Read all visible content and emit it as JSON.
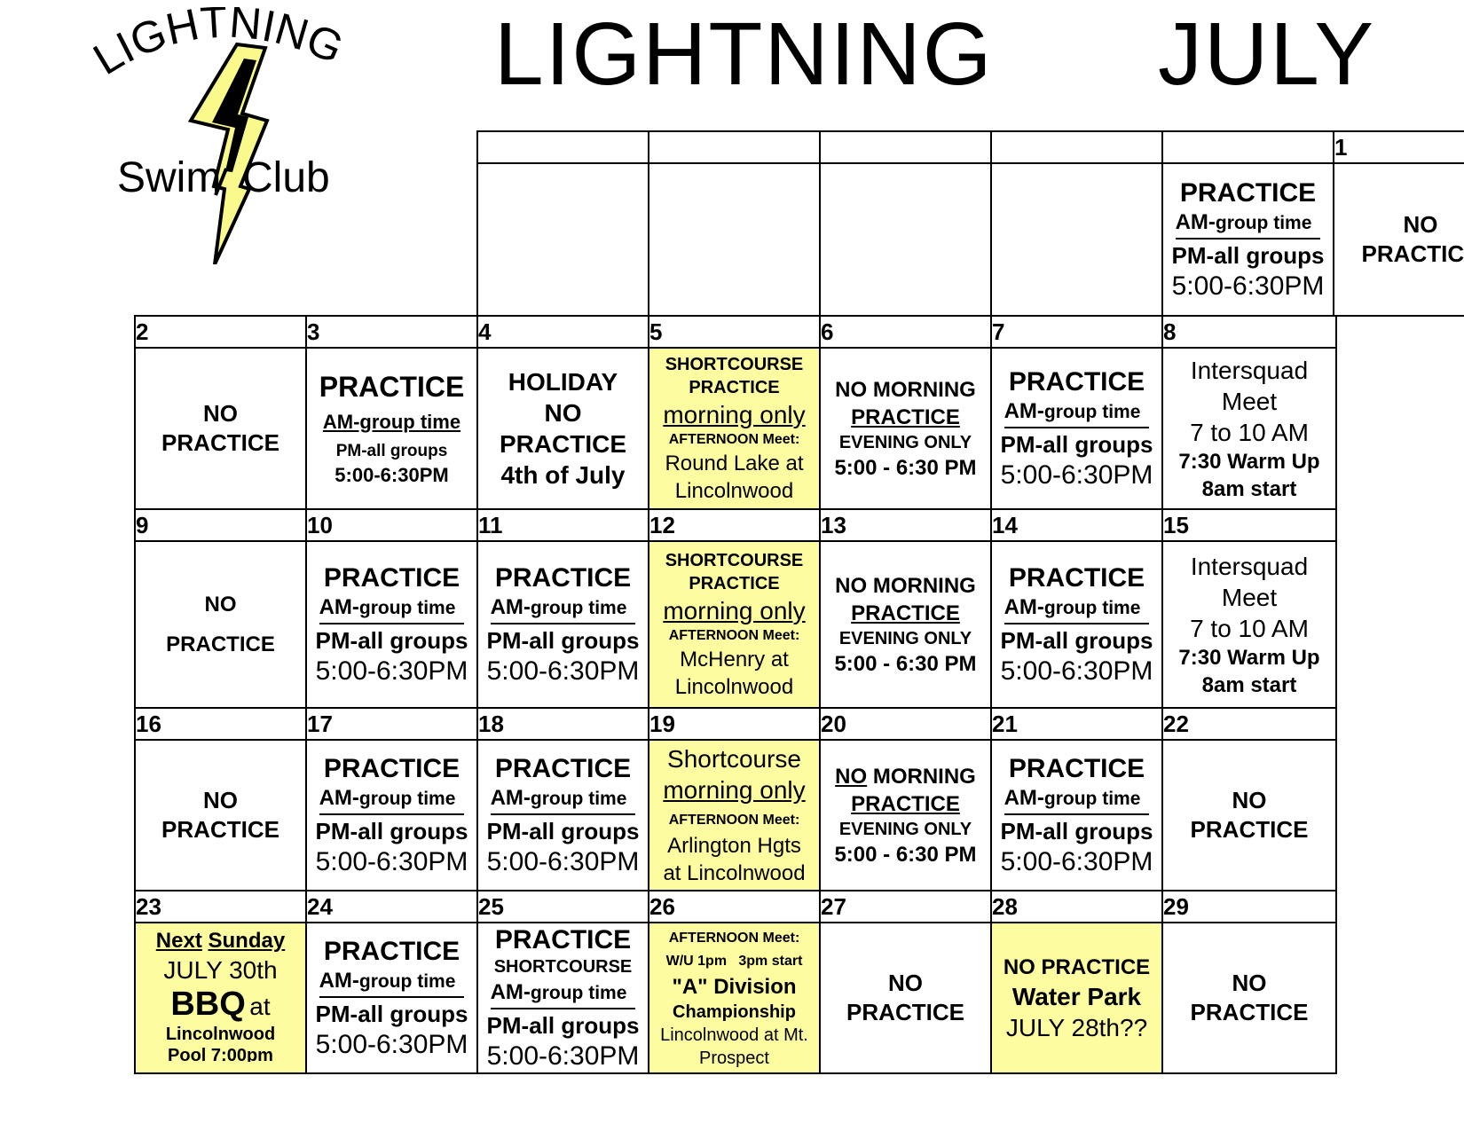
{
  "logo": {
    "top_text": "LIGHTNING",
    "left_text": "Swim",
    "right_text": "Club"
  },
  "title": {
    "left": "LIGHTNING",
    "right": "JULY"
  },
  "week1": {
    "day_numbers": [
      "",
      "",
      "",
      "",
      "",
      "1"
    ],
    "sat30": {
      "l1": "PRACTICE",
      "l2a": "AM-",
      "l2b": "group time",
      "l3": "PM-all groups",
      "l4": "5:00-6:30PM"
    },
    "sun1": {
      "l1": "NO",
      "l2": "PRACTICE"
    }
  },
  "weeks": [
    {
      "days": [
        "2",
        "3",
        "4",
        "5",
        "6",
        "7",
        "8"
      ],
      "mon": {
        "l1": "NO",
        "l2": "PRACTICE"
      },
      "tue": {
        "l1": "PRACTICE",
        "l2": "AM-group time",
        "l3": "PM-all groups",
        "l4": "5:00-6:30PM"
      },
      "wed": {
        "l1": "HOLIDAY",
        "l2": "NO",
        "l3": "PRACTICE",
        "l4": "4th of July"
      },
      "thu": {
        "l1": "SHORTCOURSE",
        "l2": "PRACTICE",
        "l3": "morning only",
        "l4": "AFTERNOON Meet:",
        "l5": "Round Lake at",
        "l6": "Lincolnwood"
      },
      "fri": {
        "l1": "NO MORNING",
        "l2": "PRACTICE",
        "l3": "EVENING ONLY",
        "l4": "5:00 - 6:30 PM"
      },
      "sat": {
        "l1": "PRACTICE",
        "l2a": "AM-",
        "l2b": "group time",
        "l3": "PM-all groups",
        "l4": "5:00-6:30PM"
      },
      "sun": {
        "l1": "Intersquad",
        "l2": "Meet",
        "l3": "7 to 10 AM",
        "l4": "7:30 Warm Up",
        "l5": "8am start"
      }
    },
    {
      "days": [
        "9",
        "10",
        "11",
        "12",
        "13",
        "14",
        "15"
      ],
      "mon": {
        "l1": "NO",
        "l2": "PRACTICE"
      },
      "tue": {
        "l1": "PRACTICE",
        "l2a": "AM-",
        "l2b": "group time",
        "l3": "PM-all groups",
        "l4": "5:00-6:30PM"
      },
      "wed": {
        "l1": "PRACTICE",
        "l2a": "AM-",
        "l2b": "group time",
        "l3": "PM-all groups",
        "l4": "5:00-6:30PM"
      },
      "thu": {
        "l1": "SHORTCOURSE",
        "l2": "PRACTICE",
        "l3": "morning only",
        "l4": "AFTERNOON Meet:",
        "l5": "McHenry at",
        "l6": "Lincolnwood"
      },
      "fri": {
        "l1": "NO MORNING",
        "l2": "PRACTICE",
        "l3": "EVENING ONLY",
        "l4": "5:00 - 6:30 PM"
      },
      "sat": {
        "l1": "PRACTICE",
        "l2a": "AM-",
        "l2b": "group time",
        "l3": "PM-all groups",
        "l4": "5:00-6:30PM"
      },
      "sun": {
        "l1": "Intersquad",
        "l2": "Meet",
        "l3": "7 to 10 AM",
        "l4": "7:30 Warm Up",
        "l5": "8am start"
      }
    },
    {
      "days": [
        "16",
        "17",
        "18",
        "19",
        "20",
        "21",
        "22"
      ],
      "mon": {
        "l1": "NO",
        "l2": "PRACTICE"
      },
      "tue": {
        "l1": "PRACTICE",
        "l2a": "AM-",
        "l2b": "group time",
        "l3": "PM-all groups",
        "l4": "5:00-6:30PM"
      },
      "wed": {
        "l1": "PRACTICE",
        "l2a": "AM-",
        "l2b": "group time",
        "l3": "PM-all groups",
        "l4": "5:00-6:30PM"
      },
      "thu": {
        "l1": "Shortcourse",
        "l2": "morning only",
        "l3": "AFTERNOON Meet:",
        "l4": "Arlington Hgts",
        "l5": "at Lincolnwood"
      },
      "fri": {
        "l1a": "NO",
        "l1b": " MORNING",
        "l2": "PRACTICE",
        "l3": "EVENING ONLY",
        "l4": "5:00 - 6:30 PM"
      },
      "sat": {
        "l1": "PRACTICE",
        "l2a": "AM-",
        "l2b": "group time",
        "l3": "PM-all groups",
        "l4": "5:00-6:30PM"
      },
      "sun": {
        "l1": "NO",
        "l2": "PRACTICE"
      }
    },
    {
      "days": [
        "23",
        "24",
        "25",
        "26",
        "27",
        "28",
        "29"
      ],
      "mon": {
        "l1a": "Next",
        "l1b": "Sunday",
        "l2": "JULY 30th",
        "l3a": "BBQ",
        "l3b": "at",
        "l4": "Lincolnwood",
        "l5": "Pool 7:00pm"
      },
      "tue": {
        "l1": "PRACTICE",
        "l2a": "AM-",
        "l2b": "group time",
        "l3": "PM-all groups",
        "l4": "5:00-6:30PM"
      },
      "wed": {
        "l1": "PRACTICE",
        "l2": "SHORTCOURSE",
        "l3a": "AM-",
        "l3b": "group time",
        "l4": "PM-all groups",
        "l5": "5:00-6:30PM"
      },
      "thu": {
        "l1": "AFTERNOON Meet:",
        "l2": "W/U 1pm   3pm start",
        "l3": "\"A\" Division",
        "l4": "Championship",
        "l5": "Lincolnwood at Mt.",
        "l6": "Prospect"
      },
      "fri": {
        "l1": "NO",
        "l2": "PRACTICE"
      },
      "sat": {
        "l1": "NO PRACTICE",
        "l2": "Water Park",
        "l3": "JULY 28th??"
      },
      "sun": {
        "l1": "NO",
        "l2": "PRACTICE"
      }
    }
  ]
}
